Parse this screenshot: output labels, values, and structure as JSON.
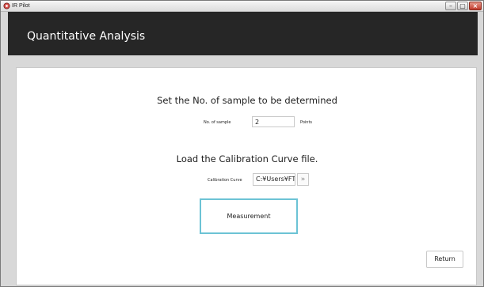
{
  "window": {
    "title": "IR Pilot",
    "min_label": "–",
    "max_label": "▢",
    "close_label": "×"
  },
  "header": {
    "title": "Quantitative Analysis"
  },
  "samples_section": {
    "heading": "Set the No. of sample to be determined",
    "label": "No. of sample",
    "value": "2",
    "units": "Points"
  },
  "calibration_section": {
    "heading": "Load the Calibration Curve file.",
    "label": "Calibration Curve",
    "value": "C:¥Users¥FTIR",
    "browse_label": "»"
  },
  "actions": {
    "measurement_label": "Measurement",
    "return_label": "Return"
  },
  "colors": {
    "header_bg": "#262626",
    "measurement_border": "#6cc3d5",
    "close_button": "#c0392b"
  }
}
